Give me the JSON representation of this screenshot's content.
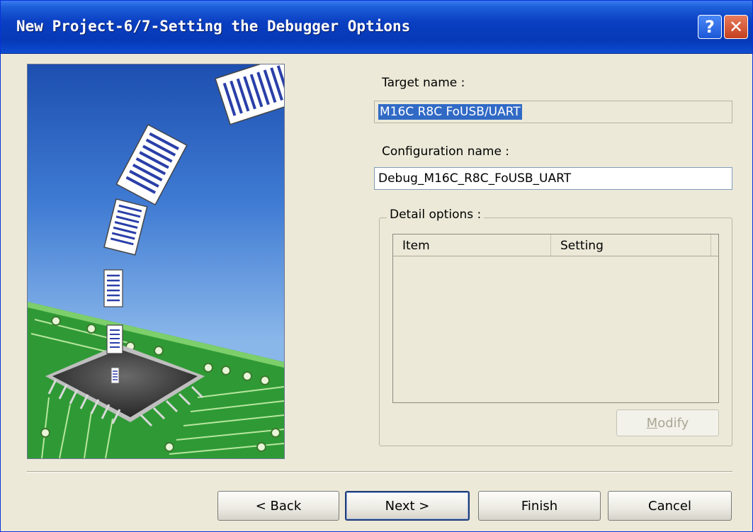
{
  "window": {
    "title": "New Project-6/7-Setting the Debugger Options",
    "help_button": "?",
    "close_button": "✕"
  },
  "form": {
    "target_label": "Target name :",
    "target_value": "M16C R8C FoUSB/UART",
    "config_label": "Configuration name :",
    "config_value": "Debug_M16C_R8C_FoUSB_UART",
    "detail_label": "Detail options :",
    "columns": [
      "Item",
      "Setting"
    ],
    "modify_mnemonic": "M",
    "modify_rest": "odify"
  },
  "buttons": {
    "back": "< Back",
    "next": "Next >",
    "finish": "Finish",
    "cancel": "Cancel"
  },
  "colors": {
    "title_bar": "#0a3fc2",
    "selection": "#316ac5",
    "dialog_bg": "#ece9d8"
  },
  "icons": [
    "help-icon",
    "close-icon"
  ]
}
